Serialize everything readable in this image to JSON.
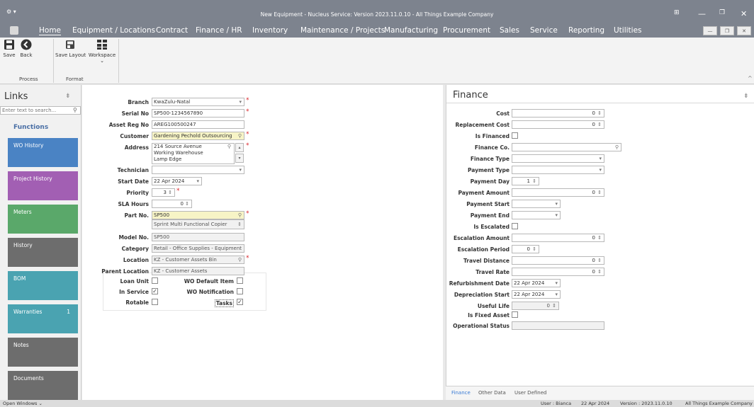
{
  "window": {
    "title": "New Equipment - Nucleus Service: Version 2023.11.0.10 - All Things Example Company"
  },
  "menu": {
    "items": [
      "Home",
      "Equipment / Locations",
      "Contract",
      "Finance / HR",
      "Inventory",
      "Maintenance / Projects",
      "Manufacturing",
      "Procurement",
      "Sales",
      "Service",
      "Reporting",
      "Utilities"
    ],
    "active": "Home"
  },
  "ribbon": {
    "save": "Save",
    "back": "Back",
    "save_layout": "Save Layout",
    "workspace": "Workspace",
    "group_process": "Process",
    "group_format": "Format"
  },
  "links": {
    "title": "Links",
    "search_placeholder": "Enter text to search...",
    "functions": "Functions",
    "tiles": [
      {
        "label": "WO History",
        "color": "#4a83c4",
        "count": ""
      },
      {
        "label": "Project History",
        "color": "#a25fb3",
        "count": ""
      },
      {
        "label": "Meters",
        "color": "#5aa86a",
        "count": ""
      },
      {
        "label": "History",
        "color": "#6d6d6d",
        "count": ""
      },
      {
        "label": "BOM",
        "color": "#4aa3b1",
        "count": ""
      },
      {
        "label": "Warranties",
        "color": "#4aa3b1",
        "count": "1"
      },
      {
        "label": "Notes",
        "color": "#6d6d6d",
        "count": ""
      },
      {
        "label": "Documents",
        "color": "#6d6d6d",
        "count": ""
      }
    ]
  },
  "form": {
    "branch": {
      "label": "Branch",
      "value": "KwaZulu-Natal"
    },
    "serial_no": {
      "label": "Serial No",
      "value": "SP500-1234567890"
    },
    "asset_reg_no": {
      "label": "Asset Reg No",
      "value": "AREG100500247"
    },
    "customer": {
      "label": "Customer",
      "value": "Gardening Pechold Outsourcing"
    },
    "address": {
      "label": "Address",
      "line1": "214 Source Avenue",
      "line2": "Working Warehouse",
      "line3": "Lamp Edge"
    },
    "technician": {
      "label": "Technician",
      "value": ""
    },
    "start_date": {
      "label": "Start Date",
      "value": "22 Apr 2024"
    },
    "priority": {
      "label": "Priority",
      "value": "3"
    },
    "sla_hours": {
      "label": "SLA Hours",
      "value": "0"
    },
    "part_no": {
      "label": "Part No.",
      "value": "SP500",
      "description": "Sprint Multi Functional Copier"
    },
    "model_no": {
      "label": "Model No.",
      "value": "SP500"
    },
    "category": {
      "label": "Category",
      "value": "Retail - Office Supplies - Equipment"
    },
    "location": {
      "label": "Location",
      "value": "KZ - Customer Assets Bin"
    },
    "parent_location": {
      "label": "Parent Location",
      "value": "KZ - Customer Assets"
    },
    "loan_unit": {
      "label": "Loan Unit",
      "checked": false
    },
    "in_service": {
      "label": "In Service",
      "checked": true
    },
    "rotable": {
      "label": "Rotable",
      "checked": false
    },
    "wo_default_item": {
      "label": "WO Default Item",
      "checked": false
    },
    "wo_notification": {
      "label": "WO Notification",
      "checked": false
    },
    "tasks": {
      "label": "Tasks",
      "checked": true
    }
  },
  "finance": {
    "title": "Finance",
    "cost": {
      "label": "Cost",
      "value": "0"
    },
    "replacement_cost": {
      "label": "Replacement Cost",
      "value": "0"
    },
    "is_financed": {
      "label": "Is Financed"
    },
    "finance_co": {
      "label": "Finance Co.",
      "value": ""
    },
    "finance_type": {
      "label": "Finance Type",
      "value": ""
    },
    "payment_type": {
      "label": "Payment Type",
      "value": ""
    },
    "payment_day": {
      "label": "Payment Day",
      "value": "1"
    },
    "payment_amount": {
      "label": "Payment Amount",
      "value": "0"
    },
    "payment_start": {
      "label": "Payment Start",
      "value": ""
    },
    "payment_end": {
      "label": "Payment End",
      "value": ""
    },
    "is_escalated": {
      "label": "Is Escalated"
    },
    "escalation_amount": {
      "label": "Escalation Amount",
      "value": "0"
    },
    "escalation_period": {
      "label": "Escalation Period",
      "value": "0"
    },
    "travel_distance": {
      "label": "Travel Distance",
      "value": "0"
    },
    "travel_rate": {
      "label": "Travel Rate",
      "value": "0"
    },
    "refurbishment_date": {
      "label": "Refurbishment Date",
      "value": "22 Apr 2024"
    },
    "depreciation_start": {
      "label": "Depreciation Start",
      "value": "22 Apr 2024"
    },
    "useful_life": {
      "label": "Useful Life",
      "value": "0"
    },
    "is_fixed_asset": {
      "label": "Is Fixed Asset"
    },
    "operational_status": {
      "label": "Operational Status",
      "value": ""
    }
  },
  "bottom_tabs": [
    "Finance",
    "Other Data",
    "User Defined"
  ],
  "status": {
    "open_windows": "Open Windows",
    "user": "User : Bianca",
    "date": "22 Apr 2024",
    "version": "Version : 2023.11.0.10",
    "company": "All Things Example Company"
  }
}
